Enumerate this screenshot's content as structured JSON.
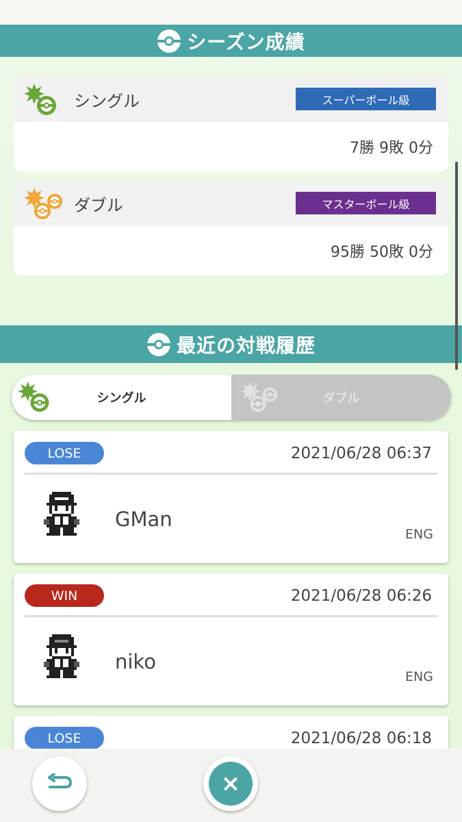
{
  "season": {
    "title": "シーズン成績"
  },
  "ranks": [
    {
      "mode": "シングル",
      "rank": "スーパーボール級",
      "rank_color": "#2f6ab7",
      "record": "7勝 9敗 0分"
    },
    {
      "mode": "ダブル",
      "rank": "マスターボール級",
      "rank_color": "#6b2f8f",
      "record": "95勝 50敗 0分"
    }
  ],
  "history": {
    "title": "最近の対戦履歴",
    "tabs": {
      "single": "シングル",
      "double": "ダブル",
      "active": "single"
    },
    "battles": [
      {
        "result": "LOSE",
        "datetime": "2021/06/28 06:37",
        "player": "GMan",
        "lang": "ENG"
      },
      {
        "result": "WIN",
        "datetime": "2021/06/28 06:26",
        "player": "niko",
        "lang": "ENG"
      },
      {
        "result": "LOSE",
        "datetime": "2021/06/28 06:18"
      }
    ]
  },
  "colors": {
    "header": "#4aa5a4",
    "single_icon": "#6aa63a",
    "double_icon": "#f0a63a",
    "lose": "#4a86d6",
    "win": "#b8281d"
  },
  "icons": {
    "section": "pokeball-icon",
    "back": "back-arrow-icon",
    "close": "close-icon"
  }
}
